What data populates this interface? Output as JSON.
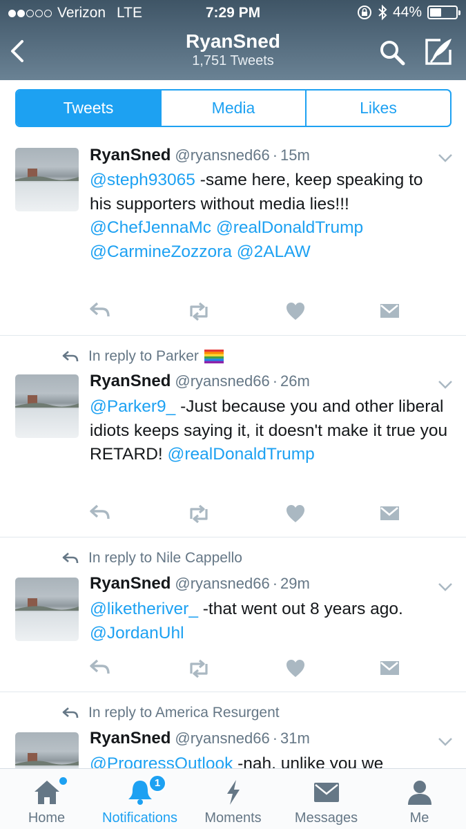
{
  "status_bar": {
    "carrier": "Verizon",
    "network": "LTE",
    "time": "7:29 PM",
    "battery": "44%",
    "battery_level": 0.44
  },
  "header": {
    "title": "RyanSned",
    "subtitle": "1,751 Tweets"
  },
  "tabs": [
    {
      "label": "Tweets",
      "active": true
    },
    {
      "label": "Media",
      "active": false
    },
    {
      "label": "Likes",
      "active": false
    }
  ],
  "tweets": [
    {
      "reply_to": "",
      "name": "RyanSned",
      "handle": "@ryansned66",
      "time": "15m",
      "segments": [
        {
          "t": "@steph93065",
          "m": true
        },
        {
          "t": " -same here, keep speaking to his supporters without media lies!!!  ",
          "m": false
        },
        {
          "t": "@ChefJennaMc",
          "m": true
        },
        {
          "t": " ",
          "m": false
        },
        {
          "t": "@realDonaldTrump",
          "m": true
        },
        {
          "t": " ",
          "m": false
        },
        {
          "t": "@CarmineZozzora",
          "m": true
        },
        {
          "t": " ",
          "m": false
        },
        {
          "t": "@2ALAW",
          "m": true
        }
      ]
    },
    {
      "reply_to": "In reply to Parker",
      "reply_emoji": "rainbow-flag-icon",
      "name": "RyanSned",
      "handle": "@ryansned66",
      "time": "26m",
      "segments": [
        {
          "t": "@Parker9_",
          "m": true
        },
        {
          "t": " -Just because you and other liberal idiots keeps saying it, it doesn't make it true you RETARD! ",
          "m": false
        },
        {
          "t": "@realDonaldTrump",
          "m": true
        }
      ]
    },
    {
      "reply_to": "In reply to Nile Cappello",
      "name": "RyanSned",
      "handle": "@ryansned66",
      "time": "29m",
      "segments": [
        {
          "t": "@liketheriver_",
          "m": true
        },
        {
          "t": " -that went out 8 years ago. ",
          "m": false
        },
        {
          "t": "@JordanUhl",
          "m": true
        }
      ]
    },
    {
      "reply_to": "In reply to America Resurgent",
      "name": "RyanSned",
      "handle": "@ryansned66",
      "time": "31m",
      "segments": [
        {
          "t": "@ProgressOutlook",
          "m": true
        },
        {
          "t": " -nah, unlike you we",
          "m": false
        }
      ]
    }
  ],
  "bottom_nav": [
    {
      "label": "Home",
      "icon": "home-icon",
      "active": false
    },
    {
      "label": "Notifications",
      "icon": "bell-icon",
      "active": true,
      "badge": "1"
    },
    {
      "label": "Moments",
      "icon": "lightning-icon",
      "active": false
    },
    {
      "label": "Messages",
      "icon": "envelope-icon",
      "active": false
    },
    {
      "label": "Me",
      "icon": "person-icon",
      "active": false
    }
  ],
  "colors": {
    "accent": "#1da1f2",
    "header_bg": "#52697b",
    "muted": "#657786"
  }
}
